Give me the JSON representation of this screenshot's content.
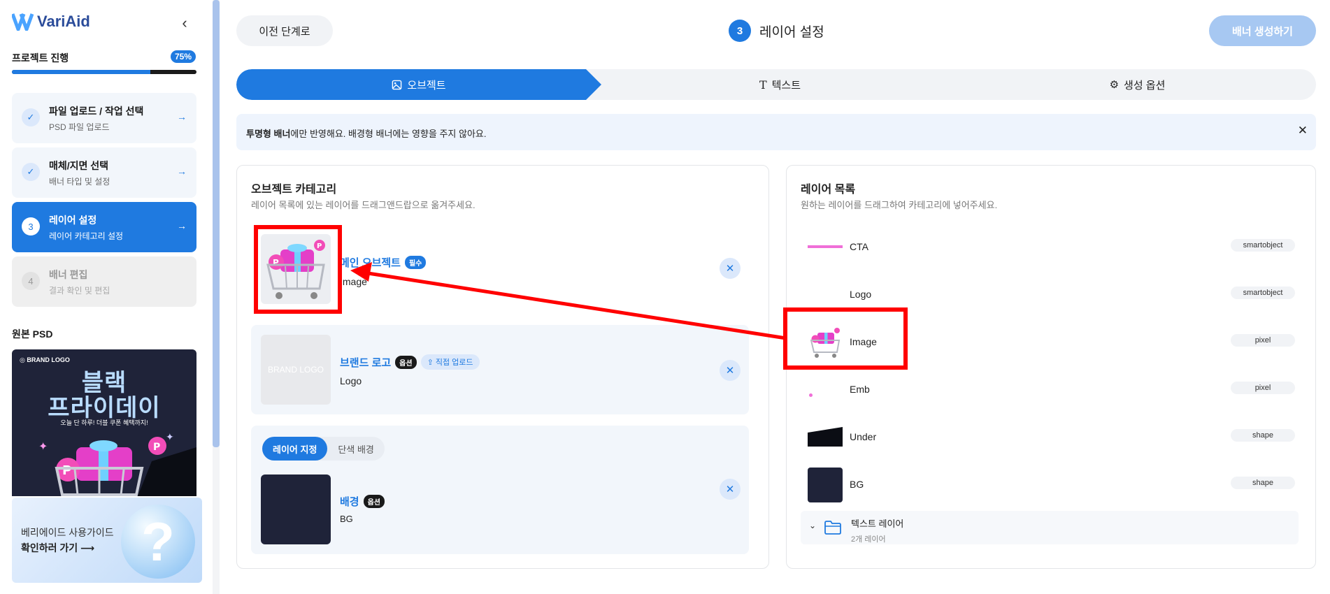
{
  "app": {
    "name": "VariAid"
  },
  "sidebar": {
    "progress_label": "프로젝트 진행",
    "progress_badge": "75%",
    "progress_value": 0.75,
    "steps": [
      {
        "num": "✓",
        "title": "파일 업로드 / 작업 선택",
        "subtitle": "PSD 파일 업로드",
        "state": "done"
      },
      {
        "num": "✓",
        "title": "매체/지면 선택",
        "subtitle": "배너 타입 및 설정",
        "state": "done"
      },
      {
        "num": "3",
        "title": "레이어 설정",
        "subtitle": "레이어 카테고리 설정",
        "state": "active"
      },
      {
        "num": "4",
        "title": "배너 편집",
        "subtitle": "결과 확인 및 편집",
        "state": "disabled"
      }
    ],
    "psd_title": "원본 PSD",
    "psd_preview": {
      "brand": "BRAND LOGO",
      "headline1": "블랙",
      "headline2": "프라이데이",
      "subline": "오늘 단 하루! 더블 쿠폰 혜택까지!"
    },
    "guide": {
      "line1": "베리에이드 사용가이드",
      "line2": "확인하러 가기 ⟶",
      "glyph": "?"
    }
  },
  "header": {
    "back_label": "이전 단계로",
    "step_num": "3",
    "title": "레이어 설정",
    "generate_label": "배너 생성하기"
  },
  "tabs": [
    {
      "label": "오브젝트",
      "icon": "image-icon",
      "active": true
    },
    {
      "label": "텍스트",
      "icon": "text-icon",
      "active": false
    },
    {
      "label": "생성 옵션",
      "icon": "gear-icon",
      "active": false
    }
  ],
  "notice": {
    "bold": "투명형 배너",
    "text": "에만 반영해요. 배경형 배너에는 영향을 주지 않아요."
  },
  "category_panel": {
    "title": "오브젝트 카테고리",
    "subtitle": "레이어 목록에 있는 레이어를 드래그앤드랍으로 옮겨주세요.",
    "cards": [
      {
        "name": "메인 오브젝트",
        "pill": "필수",
        "type": "Image"
      },
      {
        "name": "브랜드 로고",
        "pill": "옵션",
        "upload": "직접 업로드",
        "type": "Logo",
        "placeholder": "BRAND LOGO"
      },
      {
        "name": "배경",
        "pill": "옵션",
        "type": "BG",
        "seg": [
          "레이어 지정",
          "단색 배경"
        ]
      }
    ]
  },
  "layer_panel": {
    "title": "레이어 목록",
    "subtitle": "원하는 레이어를 드래그하여 카테고리에 넣어주세요.",
    "layers": [
      {
        "name": "CTA",
        "type": "smartobject"
      },
      {
        "name": "Logo",
        "type": "smartobject"
      },
      {
        "name": "Image",
        "type": "pixel"
      },
      {
        "name": "Emb",
        "type": "pixel"
      },
      {
        "name": "Under",
        "type": "shape"
      },
      {
        "name": "BG",
        "type": "shape"
      }
    ],
    "group": {
      "name": "텍스트 레이어",
      "count": "2개 레이어"
    }
  },
  "colors": {
    "accent": "#1f7ae0",
    "highlight": "#ff0000",
    "navy": "#1f2339"
  }
}
